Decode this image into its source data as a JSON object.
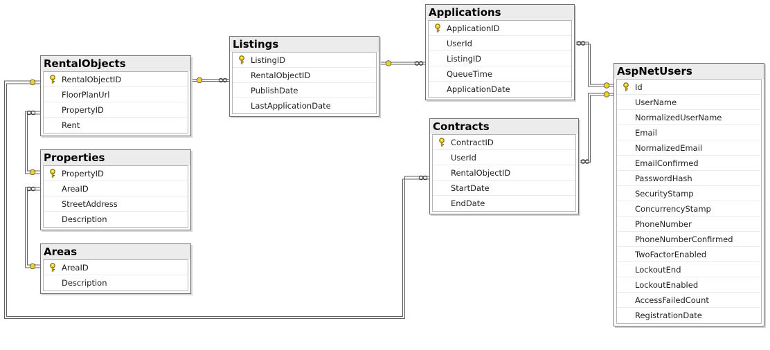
{
  "tables": {
    "rentalobjects": {
      "name": "RentalObjects",
      "columns": [
        {
          "name": "RentalObjectID",
          "pk": true
        },
        {
          "name": "FloorPlanUrl",
          "pk": false
        },
        {
          "name": "PropertyID",
          "pk": false
        },
        {
          "name": "Rent",
          "pk": false
        }
      ]
    },
    "properties": {
      "name": "Properties",
      "columns": [
        {
          "name": "PropertyID",
          "pk": true
        },
        {
          "name": "AreaID",
          "pk": false
        },
        {
          "name": "StreetAddress",
          "pk": false
        },
        {
          "name": "Description",
          "pk": false
        }
      ]
    },
    "areas": {
      "name": "Areas",
      "columns": [
        {
          "name": "AreaID",
          "pk": true
        },
        {
          "name": "Description",
          "pk": false
        }
      ]
    },
    "listings": {
      "name": "Listings",
      "columns": [
        {
          "name": "ListingID",
          "pk": true
        },
        {
          "name": "RentalObjectID",
          "pk": false
        },
        {
          "name": "PublishDate",
          "pk": false
        },
        {
          "name": "LastApplicationDate",
          "pk": false
        }
      ]
    },
    "applications": {
      "name": "Applications",
      "columns": [
        {
          "name": "ApplicationID",
          "pk": true
        },
        {
          "name": "UserId",
          "pk": false
        },
        {
          "name": "ListingID",
          "pk": false
        },
        {
          "name": "QueueTime",
          "pk": false
        },
        {
          "name": "ApplicationDate",
          "pk": false
        }
      ]
    },
    "contracts": {
      "name": "Contracts",
      "columns": [
        {
          "name": "ContractID",
          "pk": true
        },
        {
          "name": "UserId",
          "pk": false
        },
        {
          "name": "RentalObjectID",
          "pk": false
        },
        {
          "name": "StartDate",
          "pk": false
        },
        {
          "name": "EndDate",
          "pk": false
        }
      ]
    },
    "aspnetusers": {
      "name": "AspNetUsers",
      "columns": [
        {
          "name": "Id",
          "pk": true
        },
        {
          "name": "UserName",
          "pk": false
        },
        {
          "name": "NormalizedUserName",
          "pk": false
        },
        {
          "name": "Email",
          "pk": false
        },
        {
          "name": "NormalizedEmail",
          "pk": false
        },
        {
          "name": "EmailConfirmed",
          "pk": false
        },
        {
          "name": "PasswordHash",
          "pk": false
        },
        {
          "name": "SecurityStamp",
          "pk": false
        },
        {
          "name": "ConcurrencyStamp",
          "pk": false
        },
        {
          "name": "PhoneNumber",
          "pk": false
        },
        {
          "name": "PhoneNumberConfirmed",
          "pk": false
        },
        {
          "name": "TwoFactorEnabled",
          "pk": false
        },
        {
          "name": "LockoutEnd",
          "pk": false
        },
        {
          "name": "LockoutEnabled",
          "pk": false
        },
        {
          "name": "AccessFailedCount",
          "pk": false
        },
        {
          "name": "RegistrationDate",
          "pk": false
        }
      ]
    }
  },
  "relationships": [
    {
      "from": "listings",
      "to": "rentalobjects"
    },
    {
      "from": "properties",
      "to": "rentalobjects"
    },
    {
      "from": "areas",
      "to": "properties"
    },
    {
      "from": "applications",
      "to": "listings"
    },
    {
      "from": "aspnetusers",
      "to": "applications"
    },
    {
      "from": "aspnetusers",
      "to": "contracts"
    },
    {
      "from": "rentalobjects",
      "to": "contracts"
    }
  ],
  "colors": {
    "key": "#f2d21e",
    "line": "#606060",
    "header": "#ececec"
  },
  "icons": {
    "primary_key": "key-icon"
  }
}
